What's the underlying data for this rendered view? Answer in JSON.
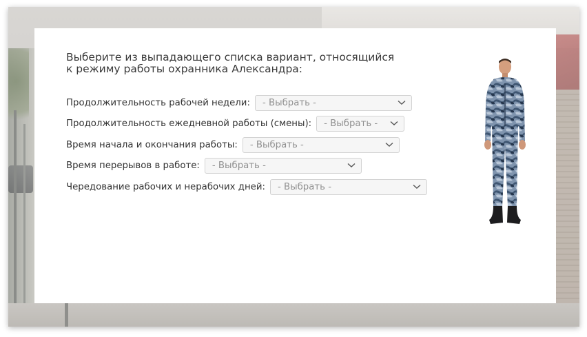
{
  "task": {
    "title_line1": "Выберите из выпадающего списка вариант, относящийся",
    "title_line2": "к режиму работы охранника Александра:"
  },
  "questions": [
    {
      "label": "Продолжительность рабочей недели:",
      "selected": "- Выбрать -"
    },
    {
      "label": "Продолжительность ежедневной работы (смены):",
      "selected": "- Выбрать -"
    },
    {
      "label": "Время начала и окончания работы:",
      "selected": "- Выбрать -"
    },
    {
      "label": "Время перерывов в работе:",
      "selected": "- Выбрать -"
    },
    {
      "label": "Чередование рабочих и нерабочих дней:",
      "selected": "- Выбрать -"
    }
  ],
  "illustration": {
    "icon": "security-guard-camouflage-figure"
  },
  "colors": {
    "panel": "#ffffff",
    "text": "#333333",
    "select_bg": "#f6f6f6",
    "placeholder": "#909090"
  }
}
